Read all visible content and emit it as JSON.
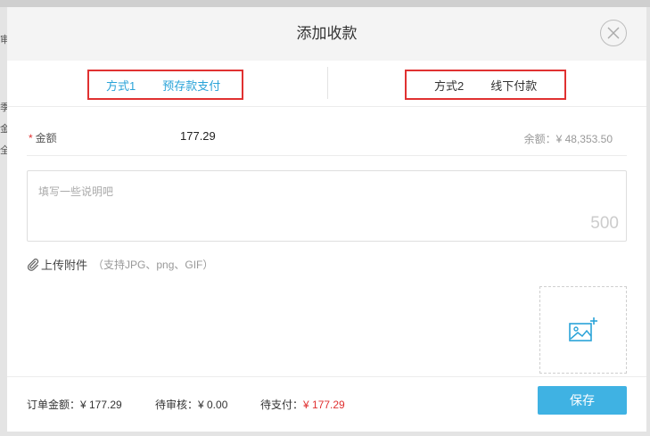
{
  "modal": {
    "title": "添加收款"
  },
  "tabs": [
    {
      "label": "方式1",
      "value": "预存款支付",
      "active": true
    },
    {
      "label": "方式2",
      "value": "线下付款",
      "active": false
    }
  ],
  "form": {
    "amount_label": "金额",
    "required_mark": "*",
    "amount_value": "177.29",
    "balance_text": "余额：¥ 48,353.50",
    "note_placeholder": "填写一些说明吧",
    "note_value": "",
    "char_count": "500",
    "upload_label": "上传附件",
    "upload_hint": "（支持JPG、png、GIF）"
  },
  "footer": {
    "order_amount": "订单金额：¥ 177.29",
    "pending_review": "待审核：¥ 0.00",
    "to_pay_label": "待支付：",
    "to_pay_value": "¥ 177.29",
    "save_label": "保存"
  },
  "background": {
    "left_glyphs": [
      "审",
      "季",
      "金",
      "全"
    ]
  },
  "colors": {
    "accent": "#3fb2e3",
    "active_tab": "#2aa3d8",
    "highlight_border": "#e03131",
    "danger": "#e03131"
  },
  "icons": {
    "close": "close-icon",
    "attachment": "paperclip-icon",
    "image_add": "image-add-icon"
  }
}
